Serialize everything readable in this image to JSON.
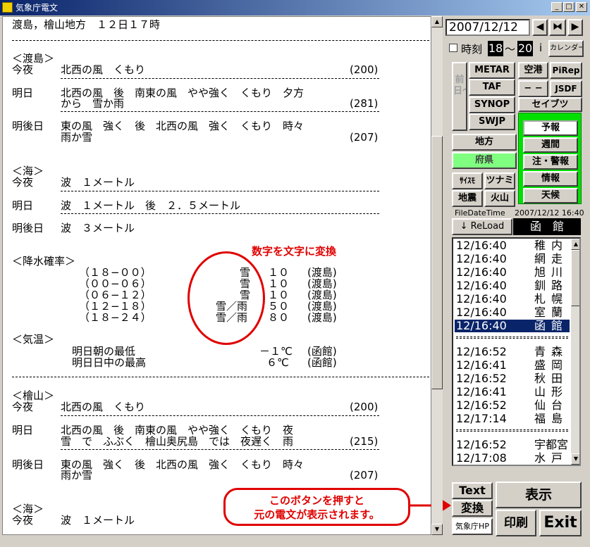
{
  "window": {
    "title": "気象庁電文"
  },
  "report": {
    "header": "渡島，檜山地方　１２日１７時",
    "s1_title": "＜渡島＞",
    "s1_r1_day": "今夜",
    "s1_r1_text": "北西の風　くもり",
    "s1_r1_code": "(200)",
    "s1_r2_day": "明日",
    "s1_r2_text1": "北西の風　後　南東の風　やや強く　くもり　夕方",
    "s1_r2_text2": "から　雪か雨",
    "s1_r2_code": "(281)",
    "s1_r3_day": "明後日",
    "s1_r3_text1": "東の風　強く　後　北西の風　強く　くもり　時々",
    "s1_r3_text2": "雨か雪",
    "s1_r3_code": "(207)",
    "sea1_title": "＜海＞",
    "sea1_r1_day": "今夜",
    "sea1_r1_text": "波　１メートル",
    "sea1_r2_day": "明日",
    "sea1_r2_text": "波　１メートル　後　２．５メートル",
    "sea1_r3_day": "明後日",
    "sea1_r3_text": "波　３メートル",
    "precip_title": "＜降水確率＞",
    "precip": [
      {
        "period": "（１８−００）",
        "weather": "雪",
        "value": "１０",
        "area": "(渡島)"
      },
      {
        "period": "（００−０６）",
        "weather": "雪",
        "value": "１０",
        "area": "(渡島)"
      },
      {
        "period": "（０６−１２）",
        "weather": "雪",
        "value": "１０",
        "area": "(渡島)"
      },
      {
        "period": "（１２−１８）",
        "weather": "雪／雨",
        "value": "５０",
        "area": "(渡島)"
      },
      {
        "period": "（１８−２４）",
        "weather": "雪／雨",
        "value": "８０",
        "area": "(渡島)"
      }
    ],
    "temp_title": "＜気温＞",
    "temp_r1_label": "明日朝の最低",
    "temp_r1_value": "－１℃",
    "temp_r1_area": "(函館)",
    "temp_r2_label": "明日日中の最高",
    "temp_r2_value": "６℃",
    "temp_r2_area": "(函館)",
    "s2_title": "＜檜山＞",
    "s2_r1_day": "今夜",
    "s2_r1_text": "北西の風　くもり",
    "s2_r1_code": "(200)",
    "s2_r2_day": "明日",
    "s2_r2_text1": "北西の風　後　南東の風　やや強く　くもり　夜",
    "s2_r2_text2": "雪　で　ふぶく　檜山奥尻島　では　夜遅く　雨",
    "s2_r2_code": "(215)",
    "s2_r3_day": "明後日",
    "s2_r3_text1": "東の風　強く　後　北西の風　強く　くもり　時々",
    "s2_r3_text2": "雨か雪",
    "s2_r3_code": "(207)",
    "sea2_title": "＜海＞",
    "sea2_r1_day": "今夜",
    "sea2_r1_text": "波　１メートル"
  },
  "annotations": {
    "top": "数字を文字に変換",
    "bottom1": "このボタンを押すと",
    "bottom2": "元の電文が表示されます。"
  },
  "controls": {
    "date": "2007/12/12",
    "time_label": "時刻",
    "hour_from": "18",
    "tilde": "〜",
    "hour_to": "20",
    "info": "i",
    "calendar": "カレンダー",
    "prev_day": "前日〜",
    "metar": "METAR",
    "taf": "TAF",
    "synop": "SYNOP",
    "swjp": "SWJP",
    "airport": "空港",
    "pirep": "PiRep",
    "dash": "− −",
    "jsdf": "JSDF",
    "safety": "セイブツ",
    "region": "地方",
    "pref": "府県",
    "forecast": "予報",
    "weekly": "週間",
    "warning": "注・警報",
    "info_btn": "情報",
    "weather": "天候",
    "seismo": "ｻｲｽﾓ",
    "tsunami": "ツナミ",
    "quake": "地震",
    "volcano": "火山",
    "filedate_label": "FileDateTime",
    "filedate_value": "2007/12/12 16:40",
    "reload": "↓ ReLoad",
    "station": "函　館",
    "text_btn": "Text",
    "convert_btn": "変換",
    "jma_hp": "気象庁HP",
    "display_btn": "表示",
    "print_btn": "印刷",
    "exit_btn": "Exit"
  },
  "stations": {
    "group1": [
      {
        "time": "12/16:40",
        "name": "稚内"
      },
      {
        "time": "12/16:40",
        "name": "網走"
      },
      {
        "time": "12/16:40",
        "name": "旭川"
      },
      {
        "time": "12/16:40",
        "name": "釧路"
      },
      {
        "time": "12/16:40",
        "name": "札幌"
      },
      {
        "time": "12/16:40",
        "name": "室蘭"
      },
      {
        "time": "12/16:40",
        "name": "函館"
      }
    ],
    "group2": [
      {
        "time": "12/16:52",
        "name": "青森"
      },
      {
        "time": "12/16:41",
        "name": "盛岡"
      },
      {
        "time": "12/16:52",
        "name": "秋田"
      },
      {
        "time": "12/16:41",
        "name": "山形"
      },
      {
        "time": "12/16:52",
        "name": "仙台"
      },
      {
        "time": "12/17:14",
        "name": "福島"
      }
    ],
    "group3": [
      {
        "time": "12/16:52",
        "name": "宇都宮"
      },
      {
        "time": "12/17:08",
        "name": "水戸"
      }
    ]
  }
}
